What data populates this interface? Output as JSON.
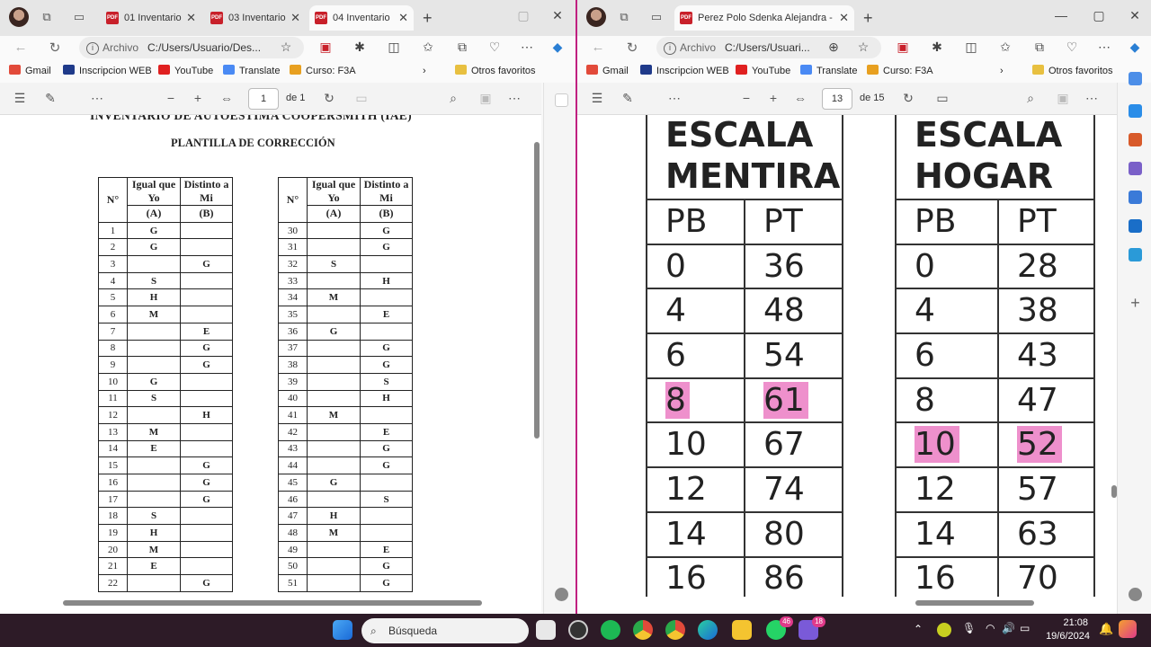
{
  "left": {
    "tabs": [
      {
        "label": "01 Inventario"
      },
      {
        "label": "03 Inventario"
      },
      {
        "label": "04 Inventario"
      }
    ],
    "address": {
      "prefix": "Archivo",
      "url": "C:/Users/Usuario/Des..."
    },
    "bookmarks": [
      "Gmail",
      "Inscripcion WEB",
      "YouTube",
      "Translate",
      "Curso: F3A",
      "Otros favoritos"
    ],
    "pdf": {
      "page": "1",
      "of": "de 1"
    },
    "doc": {
      "title": "INVENTARIO DE AUTOESTIMA COOPERSMITH (IAE)",
      "subtitle": "PLANTILLA DE CORRECCIÓN",
      "headers": {
        "n": "N°",
        "a": "Igual que Yo",
        "a2": "(A)",
        "b": "Distinto a Mi",
        "b2": "(B)"
      },
      "t1": [
        [
          "1",
          "G",
          ""
        ],
        [
          "2",
          "G",
          ""
        ],
        [
          "3",
          "",
          "G"
        ],
        [
          "4",
          "S",
          ""
        ],
        [
          "5",
          "H",
          ""
        ],
        [
          "6",
          "M",
          ""
        ],
        [
          "7",
          "",
          "E"
        ],
        [
          "8",
          "",
          "G"
        ],
        [
          "9",
          "",
          "G"
        ],
        [
          "10",
          "G",
          ""
        ],
        [
          "11",
          "S",
          ""
        ],
        [
          "12",
          "",
          "H"
        ],
        [
          "13",
          "M",
          ""
        ],
        [
          "14",
          "E",
          ""
        ],
        [
          "15",
          "",
          "G"
        ],
        [
          "16",
          "",
          "G"
        ],
        [
          "17",
          "",
          "G"
        ],
        [
          "18",
          "S",
          ""
        ],
        [
          "19",
          "H",
          ""
        ],
        [
          "20",
          "M",
          ""
        ],
        [
          "21",
          "E",
          ""
        ],
        [
          "22",
          "",
          "G"
        ]
      ],
      "t2": [
        [
          "30",
          "",
          "G"
        ],
        [
          "31",
          "",
          "G"
        ],
        [
          "32",
          "S",
          ""
        ],
        [
          "33",
          "",
          "H"
        ],
        [
          "34",
          "M",
          ""
        ],
        [
          "35",
          "",
          "E"
        ],
        [
          "36",
          "G",
          ""
        ],
        [
          "37",
          "",
          "G"
        ],
        [
          "38",
          "",
          "G"
        ],
        [
          "39",
          "",
          "S"
        ],
        [
          "40",
          "",
          "H"
        ],
        [
          "41",
          "M",
          ""
        ],
        [
          "42",
          "",
          "E"
        ],
        [
          "43",
          "",
          "G"
        ],
        [
          "44",
          "",
          "G"
        ],
        [
          "45",
          "G",
          ""
        ],
        [
          "46",
          "",
          "S"
        ],
        [
          "47",
          "H",
          ""
        ],
        [
          "48",
          "M",
          ""
        ],
        [
          "49",
          "",
          "E"
        ],
        [
          "50",
          "",
          "G"
        ],
        [
          "51",
          "",
          "G"
        ]
      ]
    }
  },
  "right": {
    "tab": "Perez Polo Sdenka Alejandra - Pr",
    "address": {
      "prefix": "Archivo",
      "url": "C:/Users/Usuari..."
    },
    "bookmarks": [
      "Gmail",
      "Inscripcion WEB",
      "YouTube",
      "Translate",
      "Curso: F3A",
      "Otros favoritos"
    ],
    "pdf": {
      "page": "13",
      "of": "de 15"
    },
    "escala_mentira": {
      "title1": "ESCALA",
      "title2": "MENTIRA",
      "pb": "PB",
      "pt": "PT",
      "rows": [
        [
          "0",
          "36"
        ],
        [
          "4",
          "48"
        ],
        [
          "6",
          "54"
        ],
        [
          "8",
          "61"
        ],
        [
          "10",
          "67"
        ],
        [
          "12",
          "74"
        ],
        [
          "14",
          "80"
        ],
        [
          "16",
          "86"
        ]
      ],
      "highlight_pb": "8"
    },
    "escala_hogar": {
      "title1": "ESCALA",
      "title2": "HOGAR",
      "pb": "PB",
      "pt": "PT",
      "rows": [
        [
          "0",
          "28"
        ],
        [
          "4",
          "38"
        ],
        [
          "6",
          "43"
        ],
        [
          "8",
          "47"
        ],
        [
          "10",
          "52"
        ],
        [
          "12",
          "57"
        ],
        [
          "14",
          "63"
        ],
        [
          "16",
          "70"
        ]
      ],
      "highlight_pb": "10"
    },
    "highlight_color": "#ee90cc"
  },
  "taskbar": {
    "search": "Búsqueda",
    "time": "21:08",
    "date": "19/6/2024",
    "badge1": "46",
    "badge2": "18"
  }
}
